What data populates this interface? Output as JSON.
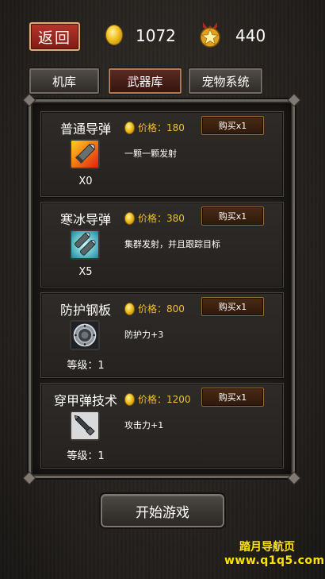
{
  "header": {
    "back_label": "返回",
    "gold": "1072",
    "stars": "440"
  },
  "tabs": [
    {
      "label": "机库",
      "active": false
    },
    {
      "label": "武器库",
      "active": true
    },
    {
      "label": "宠物系统",
      "active": false
    }
  ],
  "items": [
    {
      "name": "普通导弹",
      "price_label": "价格：",
      "price": "180",
      "buy_label": "购买x1",
      "desc": "一颗一颗发射",
      "count": "X0",
      "icon": "missile-icon"
    },
    {
      "name": "寒冰导弹",
      "price_label": "价格：",
      "price": "380",
      "buy_label": "购买x1",
      "desc": "集群发射，并且跟踪目标",
      "count": "X5",
      "icon": "ice-missile-icon"
    },
    {
      "name": "防护钢板",
      "price_label": "价格：",
      "price": "800",
      "buy_label": "购买x1",
      "desc": "防护力+3",
      "count": "等级：1",
      "icon": "steel-armor-icon"
    },
    {
      "name": "穿甲弹技术",
      "price_label": "价格：",
      "price": "1200",
      "buy_label": "购买x1",
      "desc": "攻击力+1",
      "count": "等级：1",
      "icon": "armor-piercing-shell-icon"
    }
  ],
  "start_label": "开始游戏",
  "watermark": {
    "line1": "踏月导航页",
    "line2": "www.q1q5.com"
  },
  "colors": {
    "price": "#f0c030",
    "watermark": "#ffe400",
    "back_button": "#9a2a20"
  }
}
